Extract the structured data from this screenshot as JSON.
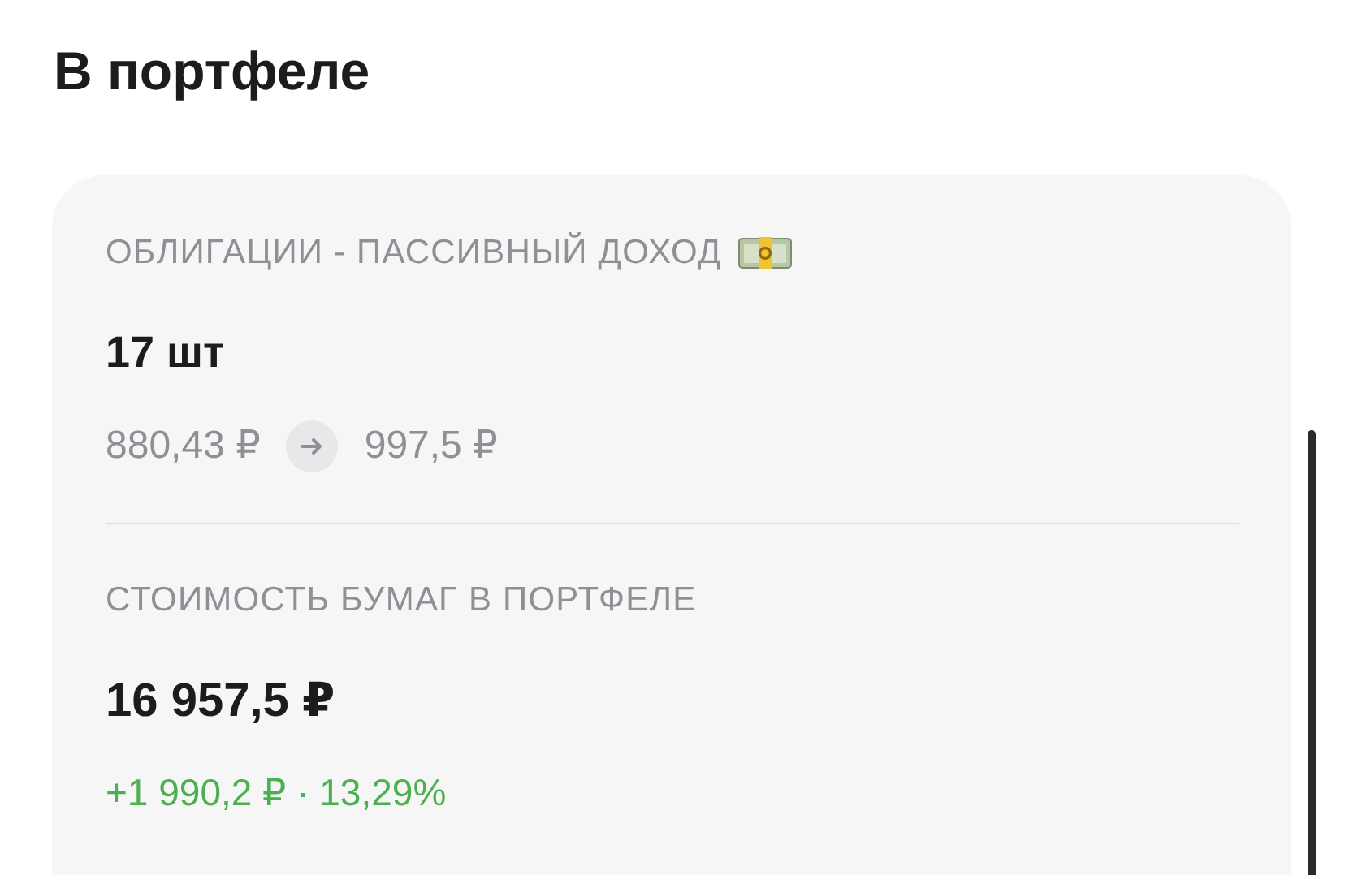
{
  "title": "В портфеле",
  "card": {
    "name": "ОБЛИГАЦИИ - ПАССИВНЫЙ ДОХОД",
    "quantity": "17 шт",
    "price_from": "880,43 ₽",
    "price_to": "997,5 ₽",
    "value_label": "СТОИМОСТЬ БУМАГ В ПОРТФЕЛЕ",
    "value": "16 957,5 ₽",
    "change": "+1 990,2 ₽ · 13,29%"
  }
}
